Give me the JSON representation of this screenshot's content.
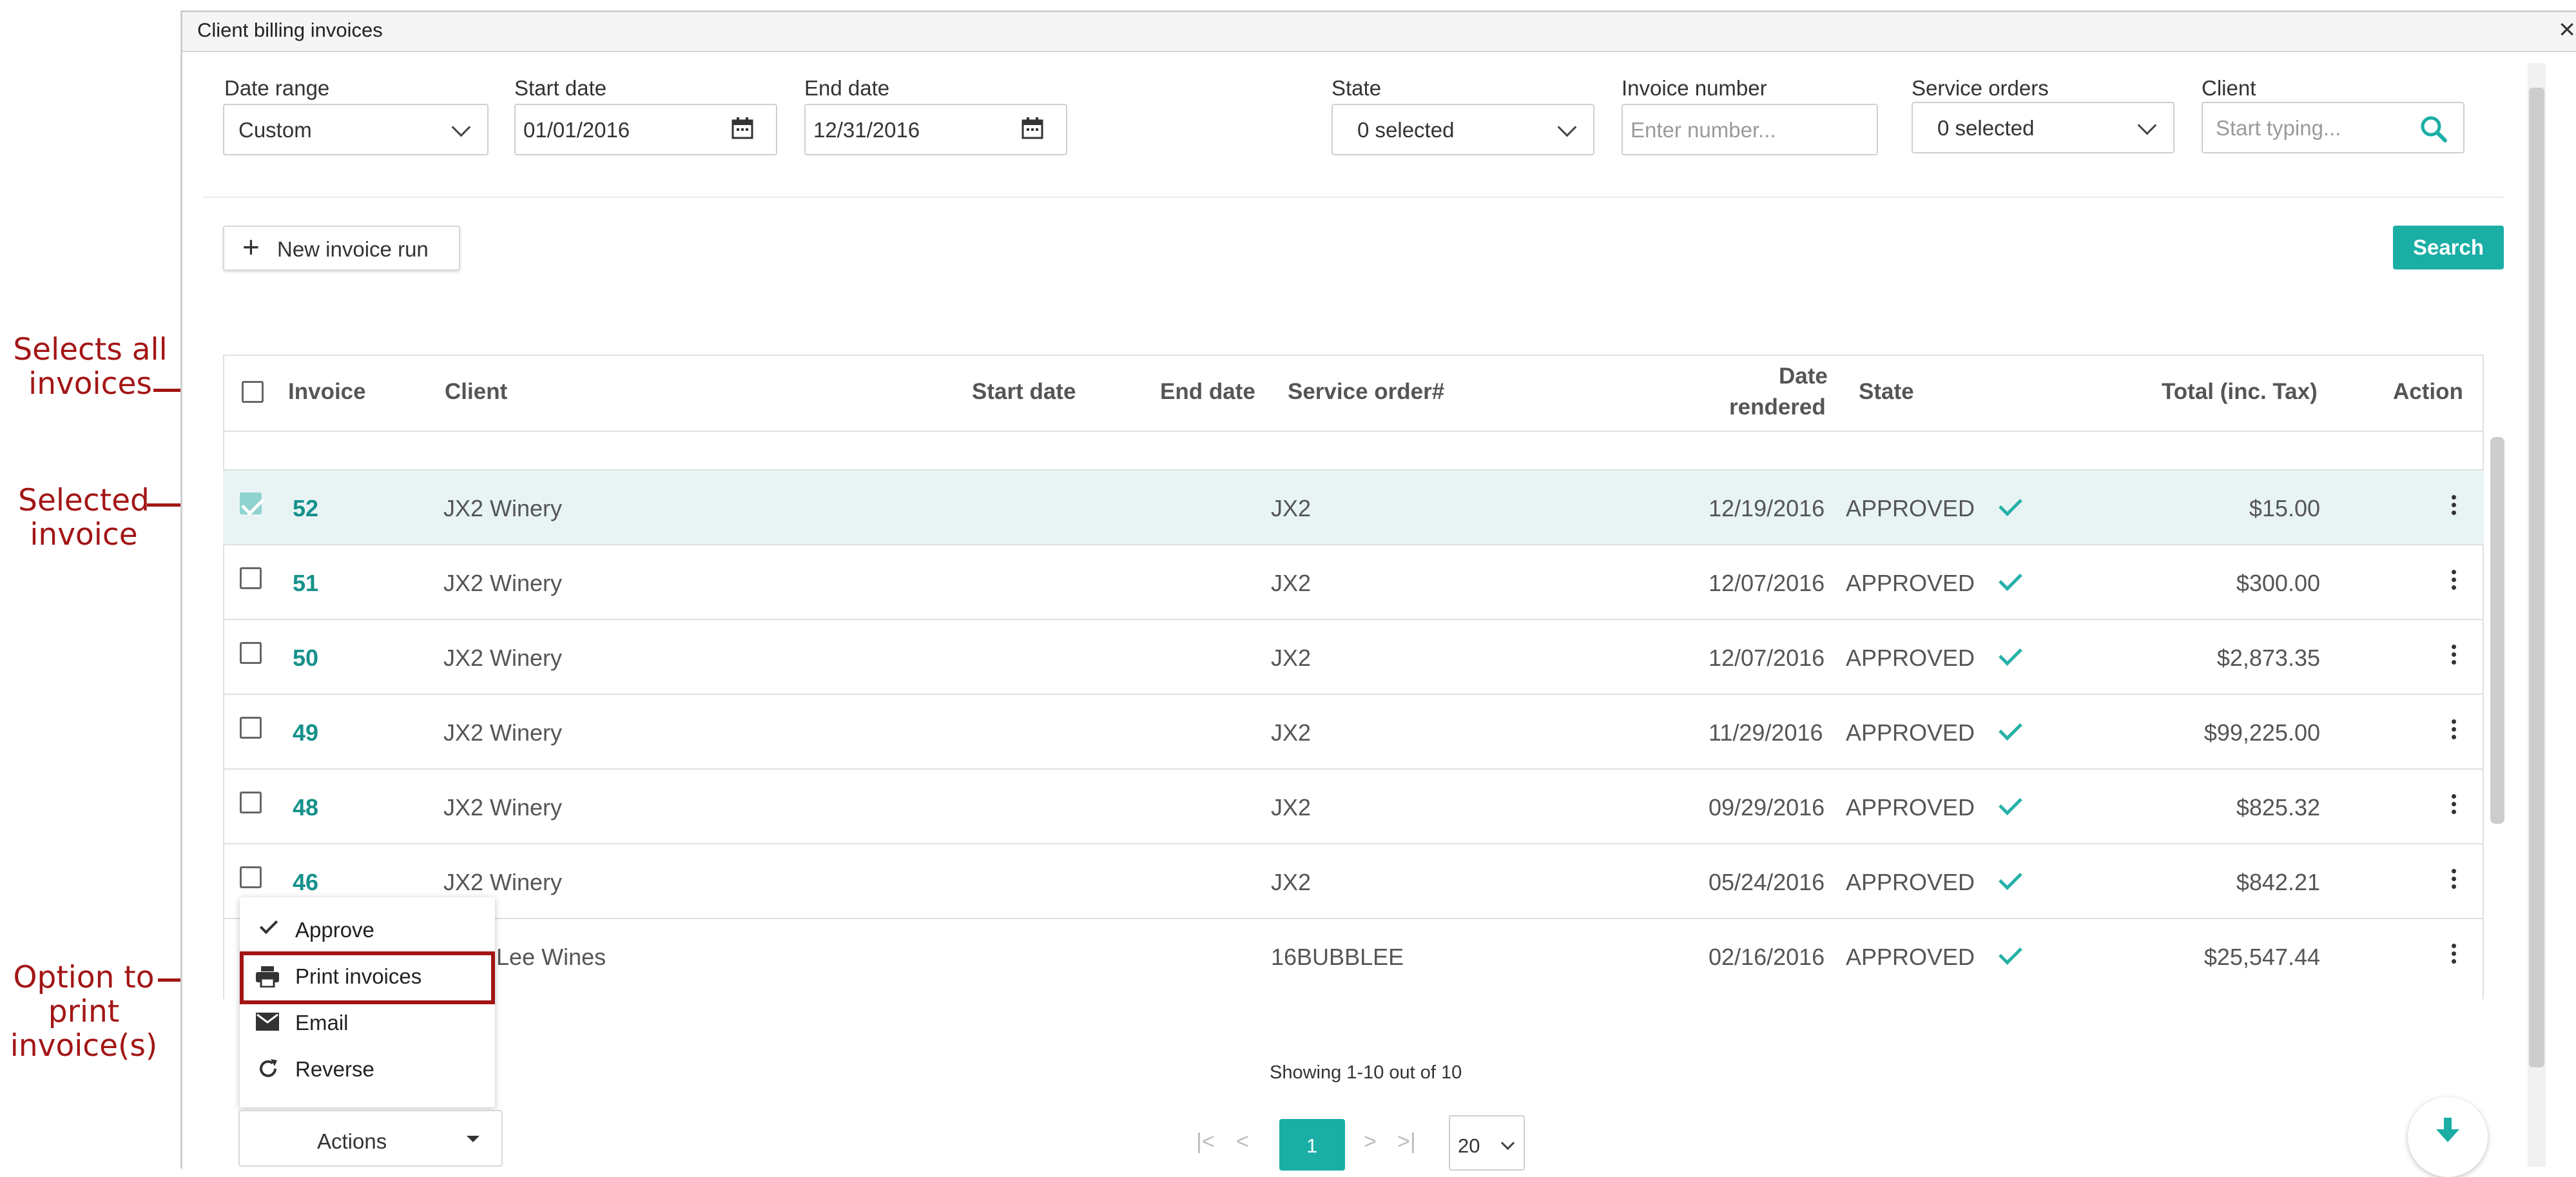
{
  "callouts": {
    "select_all": "Selects all\ninvoices",
    "selected": "Selected\ninvoice",
    "print": "Option to\nprint\ninvoice(s)"
  },
  "window": {
    "title": "Client billing invoices",
    "close": "×"
  },
  "filters": {
    "date_range": {
      "label": "Date range",
      "value": "Custom"
    },
    "start_date": {
      "label": "Start date",
      "value": "01/01/2016"
    },
    "end_date": {
      "label": "End date",
      "value": "12/31/2016"
    },
    "state": {
      "label": "State",
      "value": "0 selected"
    },
    "invoice_number": {
      "label": "Invoice number",
      "placeholder": "Enter number..."
    },
    "service_orders": {
      "label": "Service orders",
      "value": "0 selected"
    },
    "client": {
      "label": "Client",
      "placeholder": "Start typing..."
    }
  },
  "toolbar": {
    "new_invoice_run": "New invoice run",
    "search": "Search"
  },
  "table": {
    "headers": {
      "invoice": "Invoice",
      "client": "Client",
      "start_date": "Start date",
      "end_date": "End date",
      "service_order": "Service order#",
      "date_rendered_1": "Date",
      "date_rendered_2": "rendered",
      "state": "State",
      "total": "Total (inc. Tax)",
      "action": "Action"
    },
    "rows": [
      {
        "invoice": "52",
        "client": "JX2 Winery",
        "service_order": "JX2",
        "date_rendered": "12/19/2016",
        "state": "APPROVED",
        "total": "$15.00",
        "selected": true
      },
      {
        "invoice": "51",
        "client": "JX2 Winery",
        "service_order": "JX2",
        "date_rendered": "12/07/2016",
        "state": "APPROVED",
        "total": "$300.00",
        "selected": false
      },
      {
        "invoice": "50",
        "client": "JX2 Winery",
        "service_order": "JX2",
        "date_rendered": "12/07/2016",
        "state": "APPROVED",
        "total": "$2,873.35",
        "selected": false
      },
      {
        "invoice": "49",
        "client": "JX2 Winery",
        "service_order": "JX2",
        "date_rendered": "11/29/2016",
        "state": "APPROVED",
        "total": "$99,225.00",
        "selected": false
      },
      {
        "invoice": "48",
        "client": "JX2 Winery",
        "service_order": "JX2",
        "date_rendered": "09/29/2016",
        "state": "APPROVED",
        "total": "$825.32",
        "selected": false
      },
      {
        "invoice": "46",
        "client": "JX2 Winery",
        "service_order": "JX2",
        "date_rendered": "05/24/2016",
        "state": "APPROVED",
        "total": "$842.21",
        "selected": false
      },
      {
        "invoice": "",
        "client": "b Lee Wines",
        "service_order": "16BUBBLEE",
        "date_rendered": "02/16/2016",
        "state": "APPROVED",
        "total": "$25,547.44",
        "selected": false
      }
    ]
  },
  "actions_menu": {
    "items": [
      "Approve",
      "Print invoices",
      "Email",
      "Reverse"
    ],
    "button": "Actions"
  },
  "pagination": {
    "summary": "Showing 1-10 out of 10",
    "current_page": "1",
    "page_size": "20"
  },
  "colors": {
    "accent": "#1aaea5",
    "callout": "#a31515"
  }
}
